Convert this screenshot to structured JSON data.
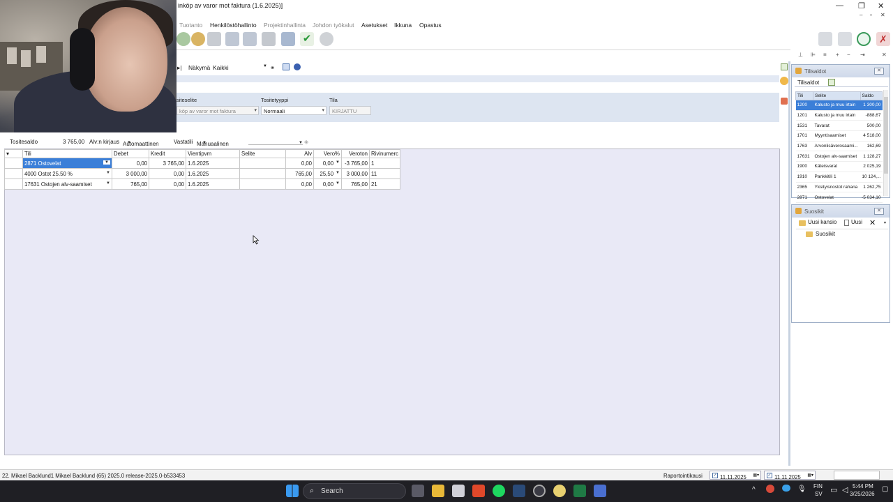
{
  "window": {
    "title": "inköp av varor mot faktura (1.6.2025)]",
    "controls": [
      "—",
      "❐",
      "✕"
    ],
    "sub_controls": [
      "–",
      "▫",
      "✕"
    ]
  },
  "menu": [
    {
      "label": "Tuotanto",
      "enabled": false
    },
    {
      "label": "Henkilöstöhallinto",
      "enabled": true
    },
    {
      "label": "Projektinhallinta",
      "enabled": false
    },
    {
      "label": "Johdon työkalut",
      "enabled": false
    },
    {
      "label": "Asetukset",
      "enabled": true
    },
    {
      "label": "Ikkuna",
      "enabled": true
    },
    {
      "label": "Opastus",
      "enabled": true
    }
  ],
  "viewbar": {
    "label": "Näkymä",
    "value": "Kaikki"
  },
  "form": {
    "description_label": "siteselite",
    "description_value": "köp av varor mot faktura",
    "type_label": "Tositetyyppi",
    "type_value": "Normaali",
    "status_label": "Tila",
    "status_value": "KIRJATTU"
  },
  "summary": {
    "saldo_label": "Tositesaldo",
    "saldo_value": "3 765,00",
    "vat_label": "Alv:n kirjaus",
    "vat_value": "Automaattinen",
    "counter_label": "Vastatili",
    "counter_value": "Manuaalinen"
  },
  "grid": {
    "headers": [
      "Tili",
      "Debet",
      "Kredit",
      "Vientipvm",
      "Selite",
      "Alv",
      "Vero%",
      "Veroton",
      "Rivinumerc"
    ],
    "rows": [
      {
        "tili": "2871 Ostovelat",
        "debet": "0,00",
        "kredit": "3 765,00",
        "pvm": "1.6.2025",
        "selite": "",
        "alv": "0,00",
        "vero": "0,00",
        "veroton": "-3 765,00",
        "rivi": "1"
      },
      {
        "tili": "4000 Ostot 25.50 %",
        "debet": "3 000,00",
        "kredit": "0,00",
        "pvm": "1.6.2025",
        "selite": "",
        "alv": "765,00",
        "vero": "25,50",
        "veroton": "3 000,00",
        "rivi": "11"
      },
      {
        "tili": "17631 Ostojen alv-saamiset",
        "debet": "765,00",
        "kredit": "0,00",
        "pvm": "1.6.2025",
        "selite": "",
        "alv": "0,00",
        "vero": "0,00",
        "veroton": "765,00",
        "rivi": "21"
      }
    ]
  },
  "tilisaldot": {
    "title": "Tilisaldot",
    "tab": "Tilisaldot",
    "headers": [
      "Tili",
      "Selite",
      "Saldo"
    ],
    "rows": [
      {
        "tili": "1200",
        "selite": "Kalusto ja muu irtain",
        "saldo": "1 300,00"
      },
      {
        "tili": "1201",
        "selite": "Kalusto ja muu irtain",
        "saldo": "-888,67"
      },
      {
        "tili": "1531",
        "selite": "Tavarat",
        "saldo": "500,00"
      },
      {
        "tili": "1701",
        "selite": "Myyntisaamiset",
        "saldo": "4 518,00"
      },
      {
        "tili": "1763",
        "selite": "Arvonlisäverosaami...",
        "saldo": "162,69"
      },
      {
        "tili": "17631",
        "selite": "Ostojen alv-saamiset",
        "saldo": "1 128,27"
      },
      {
        "tili": "1900",
        "selite": "Käteisvarat",
        "saldo": "2 025,19"
      },
      {
        "tili": "1910",
        "selite": "Pankkitili 1",
        "saldo": "10 124,..."
      },
      {
        "tili": "2365",
        "selite": "Yksityisnostot rahana",
        "saldo": "1 262,75"
      },
      {
        "tili": "2871",
        "selite": "Ostovelat",
        "saldo": "-5 034,10"
      }
    ]
  },
  "suosikit": {
    "title": "Suosikit",
    "new_folder": "Uusi kansio",
    "new": "Uusi",
    "folder": "Suosikit"
  },
  "status": {
    "user": "22. Mikael Backlund1  Mikael Backlund (65)  2025.0 release-2025.0-b533453",
    "period_label": "Raportointikausi",
    "date_from": "11.11.2025",
    "date_to": "11.11.2025"
  },
  "taskbar": {
    "search": "Search",
    "lang1": "FIN",
    "lang2": "SV",
    "time": "5:44 PM",
    "date": "3/25/2026"
  },
  "colors": {
    "selection": "#3b7fd8",
    "form_band": "#dde5f1",
    "grid_bg": "#e9e9f6",
    "taskbar": "#1f1f24"
  }
}
